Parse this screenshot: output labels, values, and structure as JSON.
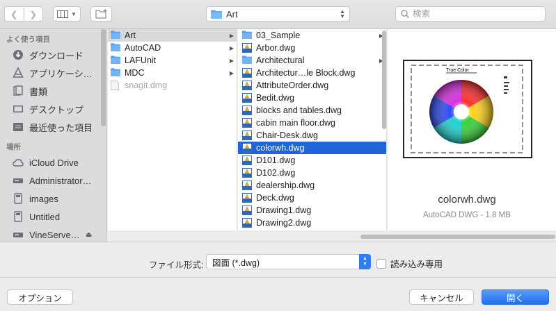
{
  "toolbar": {
    "path_label": "Art",
    "search_placeholder": "検索"
  },
  "sidebar": {
    "favorites_header": "よく使う項目",
    "favorites": [
      {
        "label": "ダウンロード",
        "icon": "download-icon"
      },
      {
        "label": "アプリケーシ…",
        "icon": "applications-icon"
      },
      {
        "label": "書類",
        "icon": "documents-icon"
      },
      {
        "label": "デスクトップ",
        "icon": "desktop-icon"
      },
      {
        "label": "最近使った項目",
        "icon": "recents-icon"
      }
    ],
    "locations_header": "場所",
    "locations": [
      {
        "label": "iCloud Drive",
        "icon": "cloud-icon"
      },
      {
        "label": "Administrator…",
        "icon": "drive-icon"
      },
      {
        "label": "images",
        "icon": "disk-icon"
      },
      {
        "label": "Untitled",
        "icon": "disk-icon"
      },
      {
        "label": "VineServe…",
        "icon": "drive-icon"
      }
    ]
  },
  "column1": [
    {
      "label": "Art",
      "type": "folder",
      "arrow": true,
      "selected": true
    },
    {
      "label": "AutoCAD",
      "type": "folder",
      "arrow": true
    },
    {
      "label": "LAFUnit",
      "type": "folder",
      "arrow": true
    },
    {
      "label": "MDC",
      "type": "folder",
      "arrow": true
    },
    {
      "label": "snagit.dmg",
      "type": "file",
      "dim": true
    }
  ],
  "column2": [
    {
      "label": "03_Sample",
      "type": "folder",
      "arrow": true
    },
    {
      "label": "Arbor.dwg",
      "type": "dwg"
    },
    {
      "label": "Architectural",
      "type": "folder",
      "arrow": true
    },
    {
      "label": "Architectur…le Block.dwg",
      "type": "dwg"
    },
    {
      "label": "AttributeOrder.dwg",
      "type": "dwg"
    },
    {
      "label": "Bedit.dwg",
      "type": "dwg"
    },
    {
      "label": "blocks and tables.dwg",
      "type": "dwg"
    },
    {
      "label": "cabin main floor.dwg",
      "type": "dwg"
    },
    {
      "label": "Chair-Desk.dwg",
      "type": "dwg"
    },
    {
      "label": "colorwh.dwg",
      "type": "dwg",
      "selected": true
    },
    {
      "label": "D101.dwg",
      "type": "dwg"
    },
    {
      "label": "D102.dwg",
      "type": "dwg"
    },
    {
      "label": "dealership.dwg",
      "type": "dwg"
    },
    {
      "label": "Deck.dwg",
      "type": "dwg"
    },
    {
      "label": "Drawing1.dwg",
      "type": "dwg"
    },
    {
      "label": "Drawing2.dwg",
      "type": "dwg"
    }
  ],
  "preview": {
    "thumb_title": "True Color",
    "name": "colorwh.dwg",
    "info": "AutoCAD DWG - 1.8 MB"
  },
  "bottom": {
    "format_label": "ファイル形式:",
    "format_value": "図面 (*.dwg)",
    "readonly_label": "読み込み専用",
    "options_button": "オプション",
    "cancel_button": "キャンセル",
    "open_button": "開く"
  }
}
